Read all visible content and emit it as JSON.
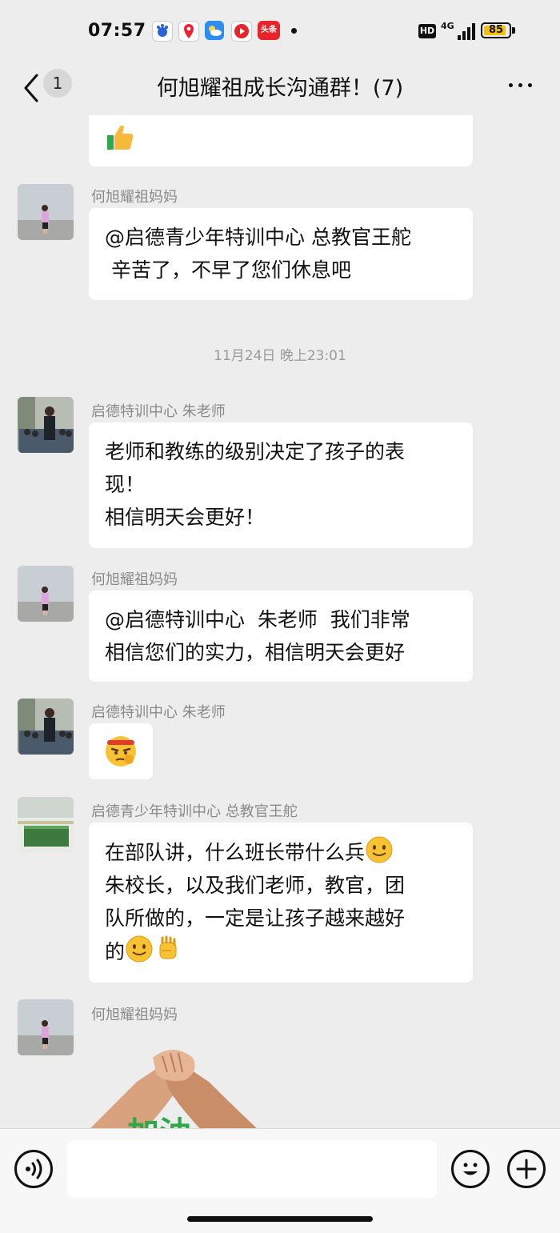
{
  "status_bar": {
    "time": "07:57",
    "hd_label": "HD",
    "network_label": "4G",
    "battery_level": "85",
    "app_icons": [
      "baidu-icon",
      "map-pin-icon",
      "weather-icon",
      "video-play-icon",
      "toutiao-icon"
    ],
    "toutiao_label": "头条"
  },
  "header": {
    "back_count": "1",
    "title": "何旭耀祖成长沟通群！(7)"
  },
  "messages": [
    {
      "type": "bubble",
      "emoji": "thumbs-up-icon"
    },
    {
      "type": "message",
      "sender": "何旭耀祖妈妈",
      "lines": [
        "@启德青少年特训中心 总教官王舵",
        " 辛苦了，不早了您们休息吧"
      ]
    },
    {
      "type": "timestamp",
      "text": "11月24日 晚上23:01"
    },
    {
      "type": "message",
      "sender": "启德特训中心  朱老师",
      "lines": [
        "老师和教练的级别决定了孩子的表",
        "现！",
        "相信明天会更好！"
      ]
    },
    {
      "type": "message",
      "sender": "何旭耀祖妈妈",
      "lines": [
        "@启德特训中心  朱老师  我们非常",
        "相信您们的实力，相信明天会更好"
      ]
    },
    {
      "type": "message",
      "sender": "启德特训中心  朱老师",
      "emoji": "determined-face-icon"
    },
    {
      "type": "message",
      "sender": "启德青少年特训中心 总教官王舵",
      "lines": [
        "在部队讲，什么班长带什么兵",
        "朱校长，以及我们老师，教官，团",
        "队所做的，一定是让孩子越来越好",
        "的"
      ]
    },
    {
      "type": "message",
      "sender": "何旭耀祖妈妈",
      "sticker": "handshake-sticker"
    }
  ],
  "input_bar": {
    "placeholder": ""
  },
  "colors": {
    "background": "#ededed",
    "bubble": "#ffffff",
    "sender": "#8a8a8a"
  }
}
